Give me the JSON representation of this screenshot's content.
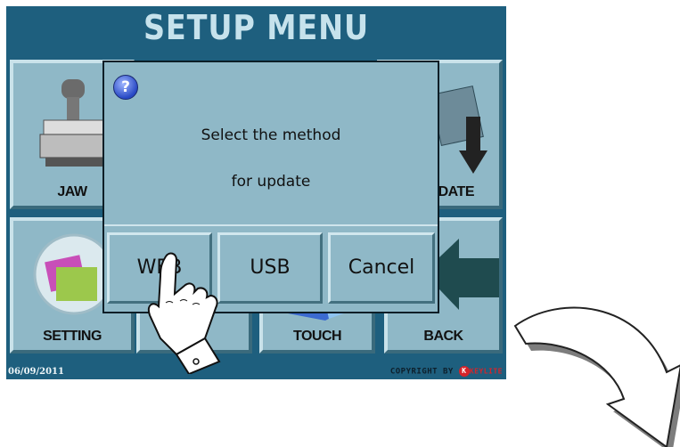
{
  "screen": {
    "title": "SETUP MENU",
    "tiles": {
      "jaw": "JAW",
      "update": "PDATE",
      "setting": "SETTING",
      "touch": "TOUCH",
      "back": "BACK"
    },
    "footer": {
      "date": "06/09/2011",
      "copyright": "COPYRIGHT BY",
      "brand_mark": "K",
      "brand": "KEYLITE"
    }
  },
  "dialog": {
    "icon": "question-icon",
    "line1": "Select the method",
    "line2": "for update",
    "buttons": {
      "web": "WEB",
      "usb": "USB",
      "cancel": "Cancel"
    }
  },
  "colors": {
    "screen_bg": "#1e5f7e",
    "tile_bg": "#8fb8c7",
    "title": "#c6e2ec"
  }
}
